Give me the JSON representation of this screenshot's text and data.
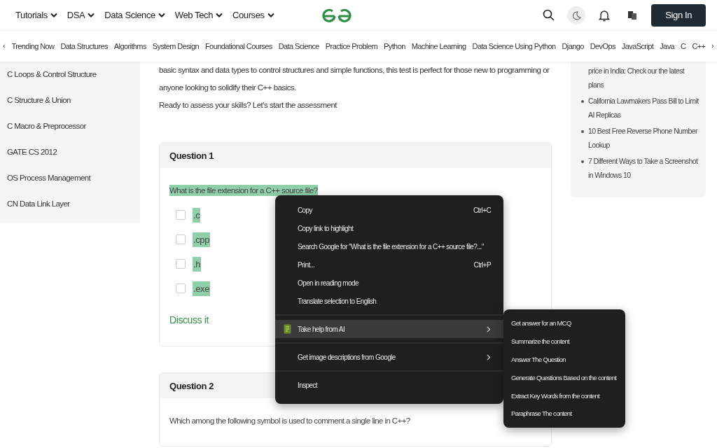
{
  "header": {
    "menus": [
      "Tutorials",
      "DSA",
      "Data Science",
      "Web Tech",
      "Courses"
    ],
    "sign_in": "Sign In"
  },
  "topics": [
    "Trending Now",
    "Data Structures",
    "Algorithms",
    "System Design",
    "Foundational Courses",
    "Data Science",
    "Practice Problem",
    "Python",
    "Machine Learning",
    "Data Science Using Python",
    "Django",
    "DevOps",
    "JavaScript",
    "Java",
    "C",
    "C++"
  ],
  "sidebar": {
    "items": [
      "C Loops & Control Structure",
      "C Structure & Union",
      "C Macro & Preprocessor",
      "GATE CS 2012",
      "OS Process Management",
      "CN Data Link Layer"
    ]
  },
  "intro": [
    "basic syntax and data types to control structures and simple functions, this test is perfect for those new to programming or anyone looking to solidify their C++ basics.",
    "Ready to assess your skills? Let's start the assessment"
  ],
  "questions": [
    {
      "title": "Question 1",
      "text": "What is the file extension for a C++ source file?",
      "highlighted": true,
      "options": [
        {
          "label": ".c",
          "checked": false,
          "highlighted": true
        },
        {
          "label": ".cpp",
          "checked": false,
          "highlighted": true
        },
        {
          "label": ".h",
          "checked": false,
          "highlighted": true
        },
        {
          "label": ".exe",
          "checked": false,
          "highlighted": true
        }
      ],
      "discuss": "Discuss it"
    },
    {
      "title": "Question 2",
      "text": "Which among the following symbol is used to comment a single line in C++?",
      "highlighted": false
    }
  ],
  "news": [
    {
      "kind": "continued",
      "text": "price in India: Check our the latest plans"
    },
    {
      "kind": "item",
      "text": "California Lawmakers Pass Bill to Limit AI Replicas"
    },
    {
      "kind": "item",
      "text": "10 Best Free Reverse Phone Number Lookup"
    },
    {
      "kind": "item",
      "text": "7 Different Ways to Take a Screenshot in Windows 10"
    }
  ],
  "context_menu": {
    "groups": [
      [
        {
          "kind": "action",
          "label": "Copy",
          "shortcut": "Ctrl+C",
          "selected": false
        },
        {
          "kind": "action",
          "label": "Copy link to highlight",
          "selected": false
        },
        {
          "kind": "action",
          "label": "Search Google for \"What is the file extension for a C++ source file?...\"",
          "selected": false
        },
        {
          "kind": "action",
          "label": "Print...",
          "shortcut": "Ctrl+P",
          "selected": false
        },
        {
          "kind": "action",
          "label": "Open in reading mode",
          "selected": false
        },
        {
          "kind": "action",
          "label": "Translate selection to English",
          "selected": false
        }
      ],
      [
        {
          "kind": "ai-submenu",
          "label": "Take help from AI",
          "selected": true
        }
      ],
      [
        {
          "kind": "submenu",
          "label": "Get image descriptions from Google",
          "selected": false
        }
      ],
      [
        {
          "kind": "action",
          "label": "Inspect",
          "selected": false
        }
      ]
    ],
    "submenu": [
      "Get answer for an MCQ",
      "Summarize the content",
      "Answer The Question",
      "Generate Questions Based on the content",
      "Extract Key Words from the content",
      "Paraphrase The content"
    ]
  }
}
